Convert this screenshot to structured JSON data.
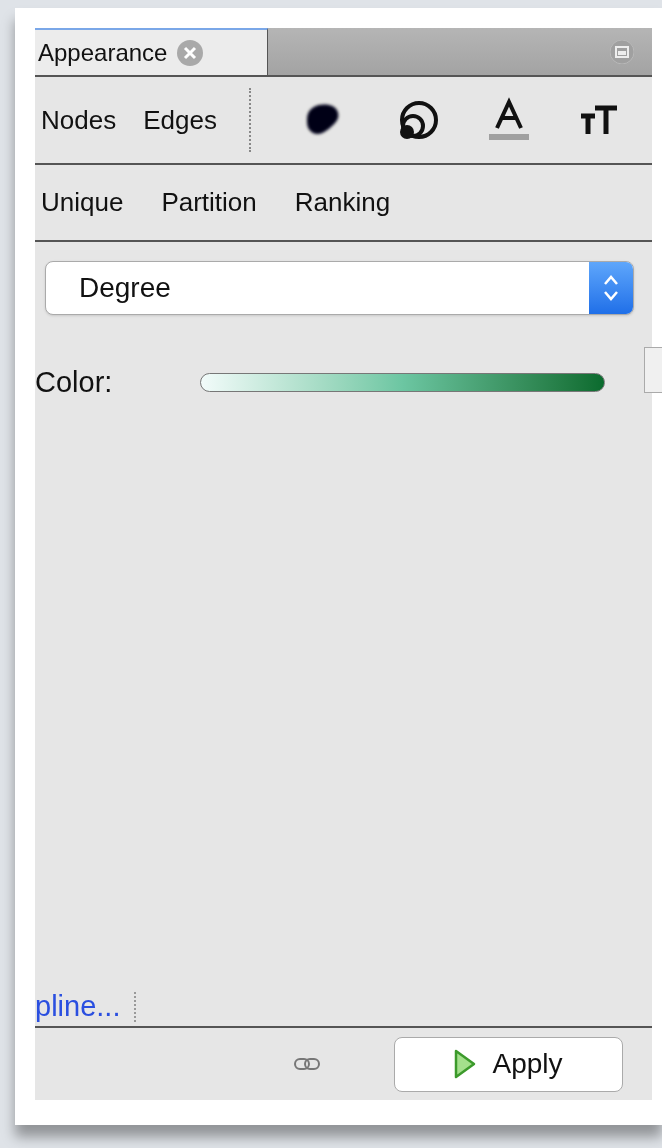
{
  "panel_tab": {
    "title": "Appearance"
  },
  "element_tabs": [
    "Nodes",
    "Edges"
  ],
  "property_icons": [
    {
      "kind": "color"
    },
    {
      "kind": "size"
    },
    {
      "kind": "label-color"
    },
    {
      "kind": "label-size"
    }
  ],
  "mode_tabs": [
    "Unique",
    "Partition",
    "Ranking"
  ],
  "attribute_select": {
    "value": "Degree"
  },
  "color_row": {
    "label": "Color:"
  },
  "spline_link": "pline...",
  "apply_button": "Apply"
}
